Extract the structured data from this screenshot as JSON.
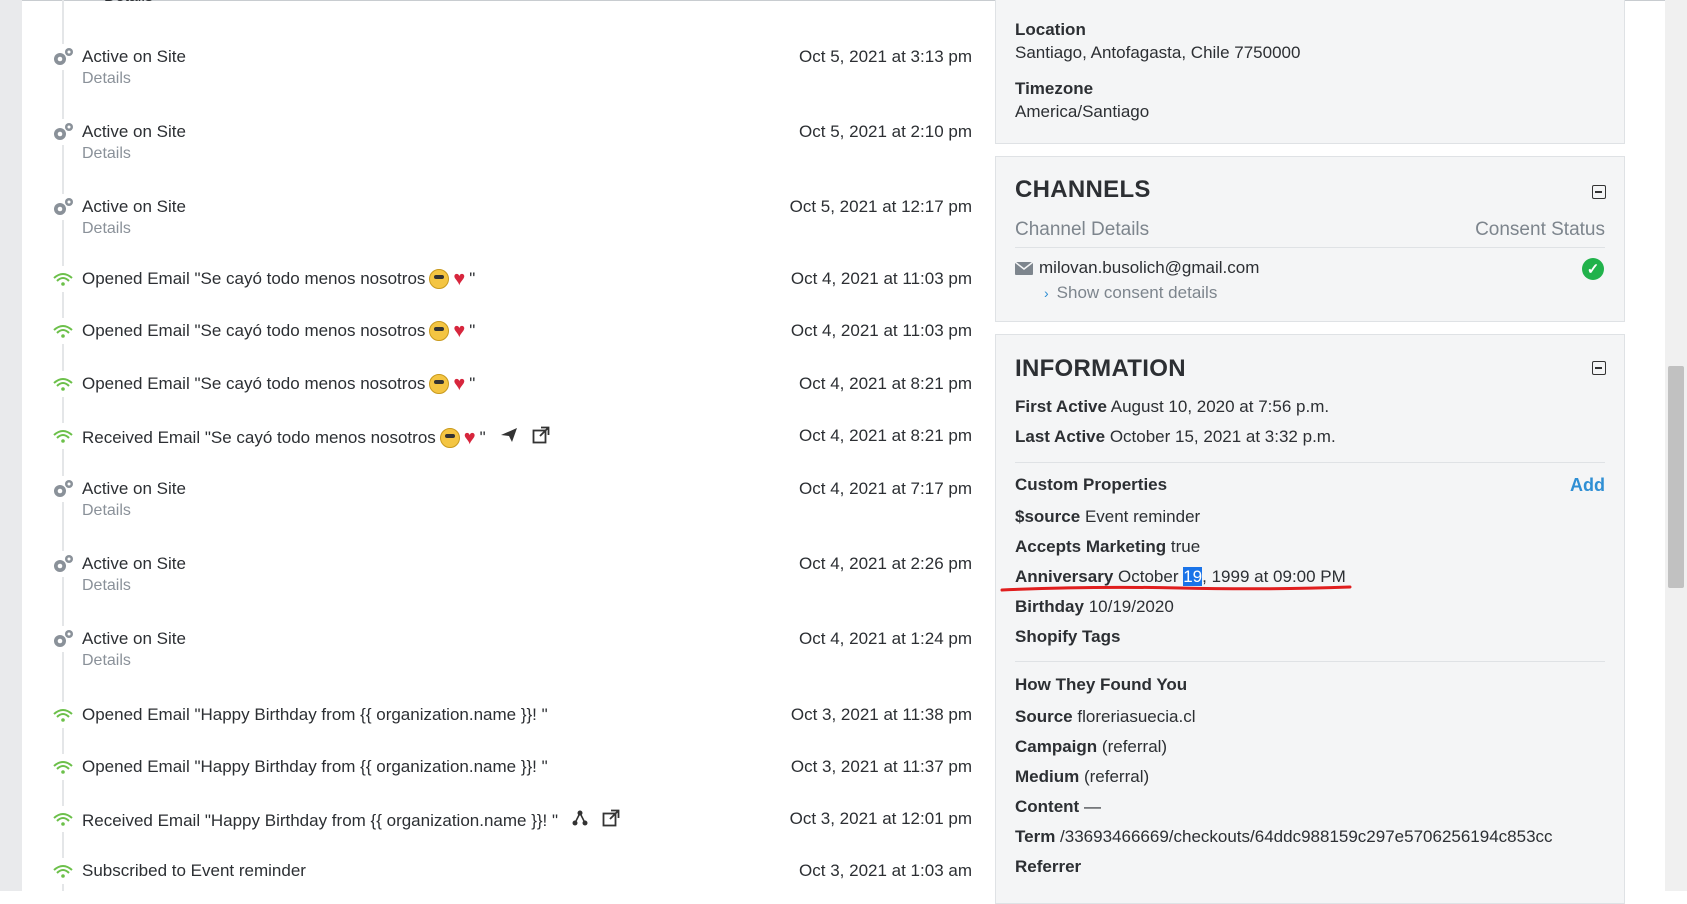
{
  "timeline": {
    "details_label": "Details",
    "events": [
      {
        "type": "activity",
        "title": "Active on Site",
        "details": true,
        "date": "Oct 5, 2021 at 3:13 pm"
      },
      {
        "type": "activity",
        "title": "Active on Site",
        "details": true,
        "date": "Oct 5, 2021 at 2:10 pm"
      },
      {
        "type": "activity",
        "title": "Active on Site",
        "details": true,
        "date": "Oct 5, 2021 at 12:17 pm"
      },
      {
        "type": "email",
        "title": "Opened Email \"Se cayó todo menos nosotros",
        "suffix": "\"",
        "emojis": true,
        "date": "Oct 4, 2021 at 11:03 pm"
      },
      {
        "type": "email",
        "title": "Opened Email \"Se cayó todo menos nosotros",
        "suffix": "\"",
        "emojis": true,
        "date": "Oct 4, 2021 at 11:03 pm"
      },
      {
        "type": "email",
        "title": "Opened Email \"Se cayó todo menos nosotros",
        "suffix": "\"",
        "emojis": true,
        "date": "Oct 4, 2021 at 8:21 pm"
      },
      {
        "type": "email",
        "title": "Received Email \"Se cayó todo menos nosotros",
        "suffix": "\"",
        "emojis": true,
        "actions": [
          "send-icon",
          "external-link-icon"
        ],
        "date": "Oct 4, 2021 at 8:21 pm"
      },
      {
        "type": "activity",
        "title": "Active on Site",
        "details": true,
        "date": "Oct 4, 2021 at 7:17 pm"
      },
      {
        "type": "activity",
        "title": "Active on Site",
        "details": true,
        "date": "Oct 4, 2021 at 2:26 pm"
      },
      {
        "type": "activity",
        "title": "Active on Site",
        "details": true,
        "date": "Oct 4, 2021 at 1:24 pm"
      },
      {
        "type": "email",
        "title": "Opened Email \"Happy Birthday from {{ organization.name }}! \"",
        "date": "Oct 3, 2021 at 11:38 pm"
      },
      {
        "type": "email",
        "title": "Opened Email \"Happy Birthday from {{ organization.name }}! \"",
        "date": "Oct 3, 2021 at 11:37 pm"
      },
      {
        "type": "email",
        "title": "Received Email \"Happy Birthday from {{ organization.name }}! \"",
        "actions": [
          "flow-icon",
          "external-link-icon"
        ],
        "date": "Oct 3, 2021 at 12:01 pm"
      },
      {
        "type": "email",
        "title": "Subscribed to Event reminder",
        "date": "Oct 3, 2021 at 1:03 am"
      }
    ]
  },
  "location_card": {
    "location_label": "Location",
    "location_value": "Santiago, Antofagasta, Chile 7750000",
    "timezone_label": "Timezone",
    "timezone_value": "America/Santiago"
  },
  "channels": {
    "title": "CHANNELS",
    "col_details": "Channel Details",
    "col_consent": "Consent Status",
    "email": "milovan.busolich@gmail.com",
    "show_consent": "Show consent details"
  },
  "information": {
    "title": "INFORMATION",
    "first_active_label": "First Active",
    "first_active_value": "August 10, 2020 at 7:56 p.m.",
    "last_active_label": "Last Active",
    "last_active_value": "October 15, 2021 at 3:32 p.m.",
    "custom_props_label": "Custom Properties",
    "add_label": "Add",
    "source_prop_label": "$source",
    "source_prop_value": "Event reminder",
    "accepts_label": "Accepts Marketing",
    "accepts_value": "true",
    "anniversary_label": "Anniversary",
    "anniversary_pre": "October ",
    "anniversary_sel": "19",
    "anniversary_post": ", 1999 at 09:00 PM",
    "birthday_label": "Birthday",
    "birthday_value": "10/19/2020",
    "shopify_label": "Shopify Tags",
    "found_label": "How They Found You",
    "source_label": "Source",
    "source_value": "floreriasuecia.cl",
    "campaign_label": "Campaign",
    "campaign_value": "(referral)",
    "medium_label": "Medium",
    "medium_value": "(referral)",
    "content_label": "Content",
    "content_value": "—",
    "term_label": "Term",
    "term_value": "/33693466669/checkouts/64ddc988159c297e5706256194c853cc",
    "referrer_label": "Referrer"
  },
  "colors": {
    "accent_link": "#2f8fd4",
    "consent_ok": "#21b24b",
    "annotation": "#e01e1e",
    "email_icon": "#6cc04a"
  }
}
